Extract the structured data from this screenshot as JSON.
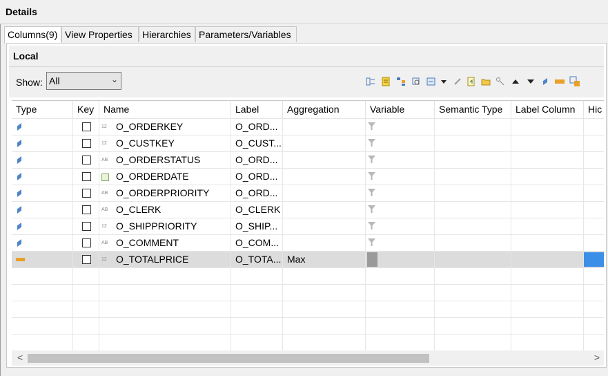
{
  "title": "Details",
  "tabs": [
    {
      "label": "Columns(9)",
      "active": true
    },
    {
      "label": "View Properties",
      "active": false
    },
    {
      "label": "Hierarchies",
      "active": false
    },
    {
      "label": "Parameters/Variables",
      "active": false
    }
  ],
  "section": {
    "title": "Local"
  },
  "show": {
    "label": "Show:",
    "value": "All"
  },
  "toolbar_icons": [
    "add-column-icon",
    "notes-icon",
    "hierarchy-icon",
    "search-tree-icon",
    "calc-column-icon",
    "dropdown-arrow-icon",
    "edit-icon",
    "export-icon",
    "folder-icon",
    "link-icon",
    "move-up-icon",
    "move-down-icon",
    "attribute-icon",
    "measure-icon",
    "settings-icon"
  ],
  "columns": [
    "Type",
    "Key",
    "Name",
    "Label",
    "Aggregation",
    "Variable",
    "Semantic Type",
    "Label Column",
    "Hic"
  ],
  "rows": [
    {
      "type": "attribute",
      "dtype": "12",
      "name": "O_ORDERKEY",
      "label": "O_ORD...",
      "aggregation": "",
      "selected": false
    },
    {
      "type": "attribute",
      "dtype": "12",
      "name": "O_CUSTKEY",
      "label": "O_CUST...",
      "aggregation": "",
      "selected": false
    },
    {
      "type": "attribute",
      "dtype": "AB",
      "name": "O_ORDERSTATUS",
      "label": "O_ORD...",
      "aggregation": "",
      "selected": false
    },
    {
      "type": "attribute",
      "dtype": "date",
      "name": "O_ORDERDATE",
      "label": "O_ORD...",
      "aggregation": "",
      "selected": false
    },
    {
      "type": "attribute",
      "dtype": "AB",
      "name": "O_ORDERPRIORITY",
      "label": "O_ORD...",
      "aggregation": "",
      "selected": false
    },
    {
      "type": "attribute",
      "dtype": "AB",
      "name": "O_CLERK",
      "label": "O_CLERK",
      "aggregation": "",
      "selected": false
    },
    {
      "type": "attribute",
      "dtype": "12",
      "name": "O_SHIPPRIORITY",
      "label": "O_SHIP...",
      "aggregation": "",
      "selected": false
    },
    {
      "type": "attribute",
      "dtype": "AB",
      "name": "O_COMMENT",
      "label": "O_COM...",
      "aggregation": "",
      "selected": false
    },
    {
      "type": "measure",
      "dtype": "12",
      "name": "O_TOTALPRICE",
      "label": "O_TOTA...",
      "aggregation": "Max",
      "selected": true
    }
  ],
  "scroll_left": "<",
  "scroll_right": ">"
}
